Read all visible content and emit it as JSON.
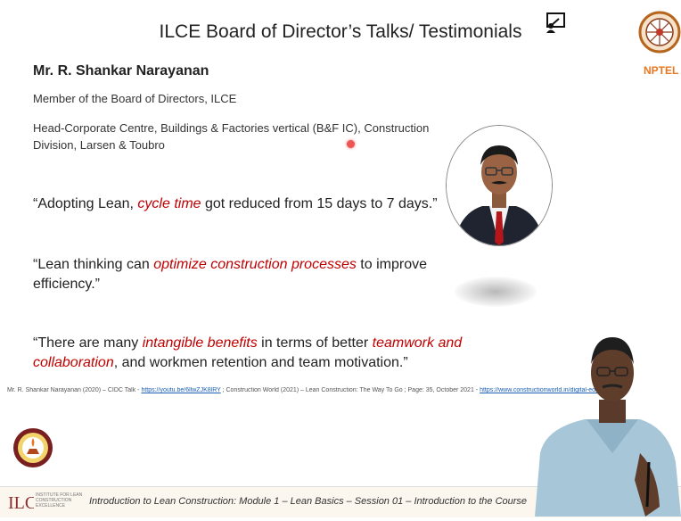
{
  "slide": {
    "title": "ILCE Board of Director’s Talks/ Testimonials",
    "person_name": "Mr. R. Shankar Narayanan",
    "role_line1": "Member of the Board of Directors, ILCE",
    "role_line2": "Head-Corporate Centre, Buildings & Factories vertical (B&F IC), Construction Division, Larsen & Toubro",
    "quote1": {
      "before": "“Adopting Lean, ",
      "emphasis": "cycle time",
      "after": " got reduced from 15 days to 7 days.”"
    },
    "quote2": {
      "before": "“Lean thinking can ",
      "emphasis": "optimize construction processes",
      "after": " to improve efficiency.”"
    },
    "quote3": {
      "before": "“There are many ",
      "emphasis1": "intangible benefits",
      "middle": " in terms of better ",
      "emphasis2": "teamwork and collaboration",
      "after": ", and workmen retention and team motivation.”"
    },
    "references": {
      "part1": "Mr. R. Shankar Narayanan (2020) – CIDC Talk - ",
      "link1": "https://youtu.be/6llwZJK8lRY",
      "part2": " ; Construction World (2021) – Lean Construction: The Way To Go ; Page: 35, October 2021 - ",
      "link2": "https://www.constructionworld.in/digital-edition"
    }
  },
  "logos": {
    "nptel_label": "NPTEL",
    "ilce_text": "INSTITUTE FOR LEAN CONSTRUCTION EXCELLENCE",
    "ilce_mark": "ILCE"
  },
  "footer": {
    "course_text": "Introduction to Lean Construction: Module 1 – Lean Basics – Session 01 – Introduction to the Course"
  },
  "colors": {
    "emphasis": "#c00000",
    "link": "#1a5fb4",
    "nptel_orange": "#e87722"
  }
}
